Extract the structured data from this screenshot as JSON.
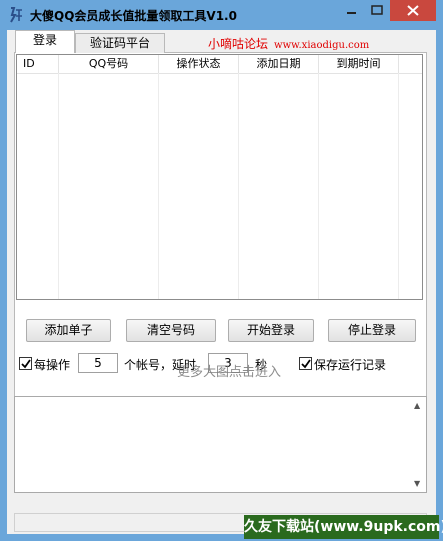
{
  "window": {
    "title": "大傻QQ会员成长值批量领取工具V1.0"
  },
  "tabs": [
    {
      "label": "登录"
    },
    {
      "label": "验证码平台"
    }
  ],
  "forum": {
    "name": "小嘀咕论坛",
    "url": "www.xiaodigu.com"
  },
  "table": {
    "columns": [
      "ID",
      "QQ号码",
      "操作状态",
      "添加日期",
      "到期时间"
    ],
    "rows": []
  },
  "buttons": {
    "add_list": "添加单子",
    "clear": "清空号码",
    "start_login": "开始登录",
    "stop_login": "停止登录"
  },
  "options": {
    "per_op_label": "每操作",
    "per_op_value": "5",
    "accounts_delay_label": "个帐号，延时",
    "delay_value": "3",
    "seconds_label": "秒",
    "save_log_label": "保存运行记录",
    "per_op_checked": true,
    "save_log_checked": true
  },
  "overlay": {
    "more_images": "更多大图点击进入"
  },
  "site_badge": "久友下载站(www.9upk.com)",
  "colors": {
    "titlebar": "#6aa6da",
    "close_button": "#c9483e",
    "forum_text": "#e00000",
    "badge_bg": "#2a6a1e"
  }
}
